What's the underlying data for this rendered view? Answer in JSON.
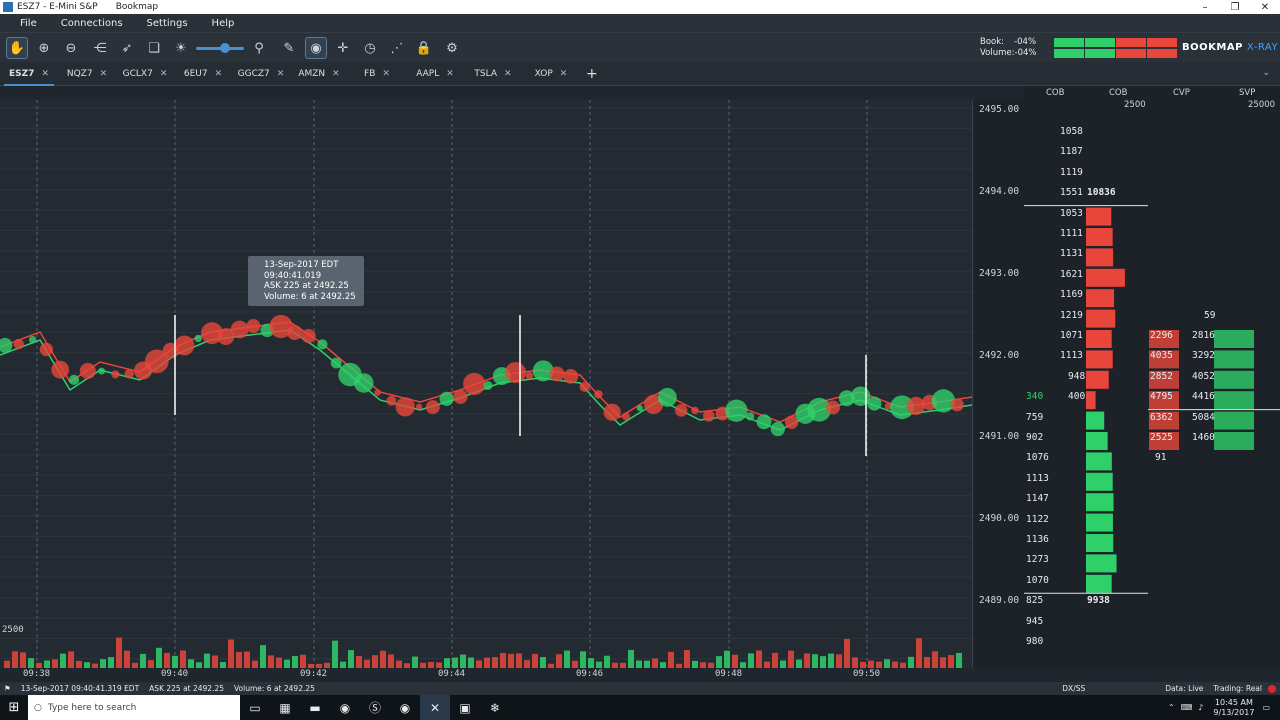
{
  "titlebar": {
    "symbol_title": "ESZ7 - E-Mini S&P",
    "app_name": "Bookmap"
  },
  "menu": [
    "File",
    "Connections",
    "Settings",
    "Help"
  ],
  "header": {
    "book_label": "Book:",
    "book_value": "-04%",
    "volume_label": "Volume:",
    "volume_value": "-04%",
    "brand": "BOOKMAP",
    "brand_suffix": "X-RAY"
  },
  "tabs": [
    {
      "label": "ESZ7",
      "active": true
    },
    {
      "label": "NQZ7"
    },
    {
      "label": "GCLX7"
    },
    {
      "label": "6EU7"
    },
    {
      "label": "GGCZ7"
    },
    {
      "label": "AMZN"
    },
    {
      "label": "FB"
    },
    {
      "label": "AAPL"
    },
    {
      "label": "TSLA"
    },
    {
      "label": "XOP"
    }
  ],
  "chart": {
    "price_axis": [
      "2495.00",
      "2494.00",
      "2493.00",
      "2492.00",
      "2491.00",
      "2490.00",
      "2489.00"
    ],
    "time_axis": [
      "09:38",
      "09:40",
      "09:42",
      "09:44",
      "09:46",
      "09:48",
      "09:50"
    ],
    "volume_scale": "2500",
    "tooltip": {
      "line1": "13-Sep-2017 EDT",
      "line2": "09:40:41.019",
      "line3": "ASK 225 at 2492.25",
      "line4": "Volume: 6 at 2492.25"
    }
  },
  "cob": {
    "headers": [
      "COB",
      "COB",
      "CVP",
      "SVP"
    ],
    "scale_cob": "2500",
    "scale_svp": "25000",
    "ask_sizes": [
      "1058",
      "1187",
      "1119",
      "1551",
      "1053",
      "1111",
      "1131",
      "1621",
      "1169",
      "1219",
      "1071",
      "1113",
      "948",
      "400"
    ],
    "ask_total": "10836",
    "bid_sizes": [
      "340",
      "759",
      "902",
      "1076",
      "1113",
      "1147",
      "1122",
      "1136",
      "1273",
      "1070",
      "825",
      "945",
      "980"
    ],
    "bid_total": "9938",
    "cvp_top": "59",
    "cvp_rows": [
      [
        "2296",
        "2816"
      ],
      [
        "4035",
        "3292"
      ],
      [
        "2852",
        "4052"
      ],
      [
        "4795",
        "4416"
      ],
      [
        "6362",
        "5084"
      ],
      [
        "2525",
        "1460"
      ]
    ],
    "cvp_bottom": "91"
  },
  "status": {
    "left": "13-Sep-2017 09:40:41.319 EDT",
    "mid": "ASK 225 at 2492.25",
    "vol": "Volume: 6 at 2492.25",
    "feed": "DX/SS",
    "data": "Data: Live",
    "trading": "Trading: Real"
  },
  "taskbar": {
    "search_placeholder": "Type here to search",
    "time": "10:45 AM",
    "date": "9/13/2017"
  },
  "colors": {
    "bid": "#2fd06a",
    "ask": "#e8463a",
    "accent": "#4a8fd0"
  }
}
